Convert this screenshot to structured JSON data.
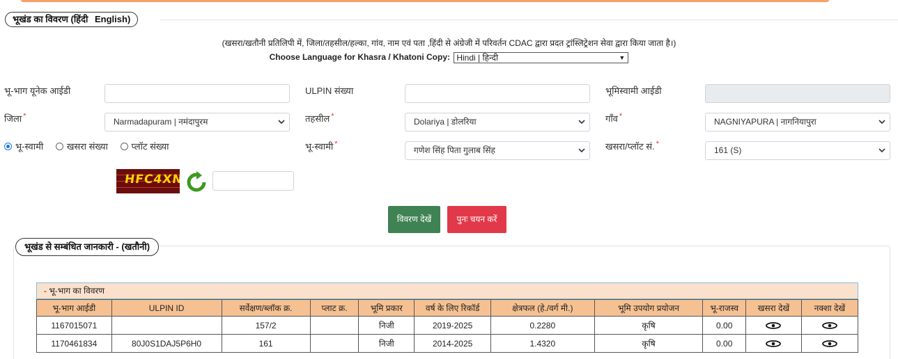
{
  "section1": {
    "legend_hindi": "भूखंड का विवरण",
    "legend_paren_open": "(",
    "legend_link_hindi": "हिंदी",
    "legend_link_english": "English",
    "legend_paren_close": ")",
    "note": "(खसरा/खतौनी प्रतिलिपी में, जिला/तहसील/हल्का, गांव, नाम एवं पता ,हिंदी से अंग्रेजी में परिवर्तन CDAC द्वारा प्रदत ट्रांस्लिट्रेशन सेवा द्वारा किया जाता है।)",
    "language_label": "Choose Language for Khasra / Khatoni Copy:",
    "language_value": "Hindi | हिन्दी"
  },
  "form": {
    "unique_id_label": "भू-भाग यूनेक आईडी",
    "ulpin_label": "ULPIN संख्या",
    "owner_id_label": "भूमिस्वामी आईडी",
    "district_label": "जिला",
    "district_value": "Narmadapuram | नमंदापुरम",
    "tehsil_label": "तहसील",
    "tehsil_value": "Dolariya | डोलरिया",
    "village_label": "गाँव",
    "village_value": "NAGNIYAPURA | नागनियापुरा",
    "required_mark": "*",
    "radio_owner": "भू-स्वामी",
    "radio_khasra": "खसरा संख्या",
    "radio_plot": "प्लॉट संख्या",
    "owner_label": "भू-स्वामी",
    "owner_value": "गणेश सिंह पिता गुलाब सिंह",
    "khasra_label": "खसरा/प्लॉट सं.",
    "khasra_value": "161 (S)",
    "captcha_text": "HFC4XN",
    "view_button": "विवरण देखें",
    "reset_button": "पुनः चयन करें"
  },
  "section2": {
    "legend": "भूखंड से सम्बंधित जानकारी -   (खतौनी)",
    "table_caption": "- भू-भाग का विवरण",
    "columns": [
      "भू-भाग आईडी",
      "ULPIN ID",
      "सर्वेक्षण/ब्लॉक क्र.",
      "प्लाट क्र.",
      "भूमि प्रकार",
      "वर्ष के लिए रिकॉर्ड",
      "क्षेत्रफल (हे./वर्ग मी.)",
      "भूमि उपयोग प्रयोजन",
      "भू-राजस्व",
      "खसरा देखें",
      "नक्शा देखें"
    ],
    "rows": [
      [
        "1167015071",
        "",
        "157/2",
        "",
        "निजी",
        "2019-2025",
        "0.2280",
        "कृषि",
        "0.00"
      ],
      [
        "1170461834",
        "80J0S1DAJ5P6H0",
        "161",
        "",
        "निजी",
        "2014-2025",
        "1.4320",
        "कृषि",
        "0.00"
      ]
    ],
    "view_icon": "eye-icon"
  }
}
